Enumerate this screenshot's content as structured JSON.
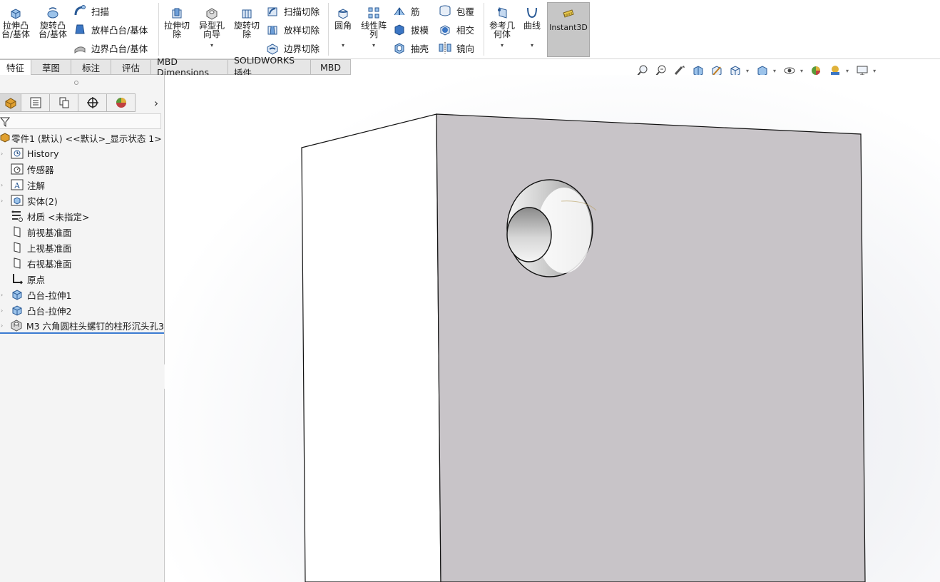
{
  "ribbon": {
    "extrude_boss": "拉伸凸\n台/基体",
    "revolve_boss": "旋转凸\n台/基体",
    "sweep": "扫描",
    "loft_boss": "放样凸台/基体",
    "boundary_boss": "边界凸台/基体",
    "extrude_cut": "拉伸切\n除",
    "hole_wizard": "异型孔\n向导",
    "revolve_cut": "旋转切\n除",
    "sweep_cut": "扫描切除",
    "loft_cut": "放样切除",
    "boundary_cut": "边界切除",
    "fillet": "圆角",
    "linear_pattern": "线性阵\n列",
    "rib": "筋",
    "draft": "拔模",
    "shell": "抽壳",
    "wrap": "包覆",
    "intersect": "相交",
    "mirror": "镜向",
    "ref_geometry": "参考几\n何体",
    "curves": "曲线",
    "instant3d": "Instant3D"
  },
  "tabs": [
    "特征",
    "草图",
    "标注",
    "评估",
    "MBD Dimensions",
    "SOLIDWORKS 插件",
    "MBD"
  ],
  "tree": {
    "root": "零件1 (默认) <<默认>_显示状态 1>",
    "items": [
      {
        "label": "History",
        "icon": "history-icon"
      },
      {
        "label": "传感器",
        "icon": "sensor-icon"
      },
      {
        "label": "注解",
        "icon": "annotation-icon"
      },
      {
        "label": "实体(2)",
        "icon": "solid-bodies-icon"
      },
      {
        "label": "材质 <未指定>",
        "icon": "material-icon"
      },
      {
        "label": "前视基准面",
        "icon": "plane-icon"
      },
      {
        "label": "上视基准面",
        "icon": "plane-icon"
      },
      {
        "label": "右视基准面",
        "icon": "plane-icon"
      },
      {
        "label": "原点",
        "icon": "origin-icon"
      },
      {
        "label": "凸台-拉伸1",
        "icon": "extrude-icon"
      },
      {
        "label": "凸台-拉伸2",
        "icon": "extrude-icon"
      },
      {
        "label": "M3 六角圆柱头螺钉的柱形沉头孔3",
        "icon": "hole-icon"
      }
    ]
  },
  "colors": {
    "face_gray": "#c8c4c8",
    "accent_blue": "#3a7ad1",
    "instant3d_bg": "#c6c6c6"
  }
}
